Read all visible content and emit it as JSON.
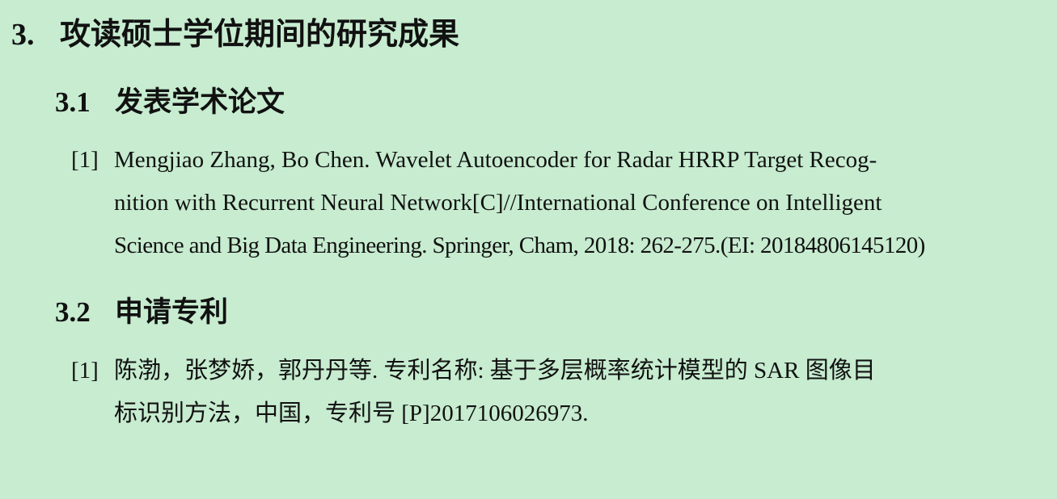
{
  "section": {
    "number": "3.",
    "title": "攻读硕士学位期间的研究成果"
  },
  "papers": {
    "number": "3.1",
    "title": "发表学术论文",
    "items": [
      {
        "index": "[1]",
        "lines": [
          "Mengjiao Zhang, Bo Chen.  Wavelet Autoencoder for Radar HRRP Target Recog-",
          "nition with Recurrent Neural Network[C]//International Conference on Intelligent",
          "Science and Big Data Engineering.  Springer, Cham, 2018:  262-275.(EI: 20184806145120)"
        ]
      }
    ]
  },
  "patents": {
    "number": "3.2",
    "title": "申请专利",
    "items": [
      {
        "index": "[1]",
        "lines": [
          "陈渤，张梦娇，郭丹丹等. 专利名称: 基于多层概率统计模型的 SAR 图像目",
          "标识别方法，中国，专利号 [P]2017106026973."
        ]
      }
    ]
  }
}
